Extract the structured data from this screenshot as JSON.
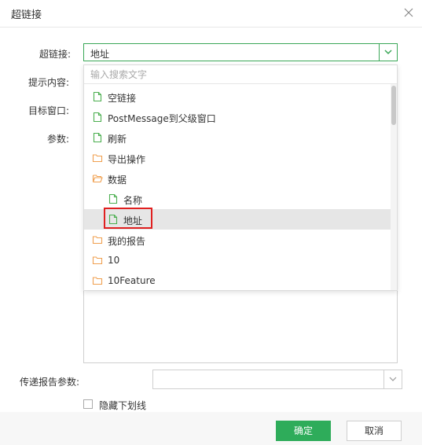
{
  "dialog": {
    "title": "超链接",
    "hyperlink_label": "超链接:",
    "hyperlink_value": "地址",
    "tooltip_label": "提示内容:",
    "target_window_label": "目标窗口:",
    "params_label": "参数:",
    "pass_params_label": "传递报告参数:",
    "underline_label": "隐藏下划线",
    "ok_label": "确定",
    "cancel_label": "取消"
  },
  "dropdown": {
    "search_placeholder": "输入搜索文字",
    "items": [
      {
        "label": "空链接",
        "type": "file",
        "depth": 0,
        "selected": false
      },
      {
        "label": "PostMessage到父级窗口",
        "type": "file",
        "depth": 0,
        "selected": false
      },
      {
        "label": "刷新",
        "type": "file",
        "depth": 0,
        "selected": false
      },
      {
        "label": "导出操作",
        "type": "folder",
        "depth": 0,
        "selected": false
      },
      {
        "label": "数据",
        "type": "folder-open",
        "depth": 0,
        "selected": false
      },
      {
        "label": "名称",
        "type": "file",
        "depth": 1,
        "selected": false
      },
      {
        "label": "地址",
        "type": "file",
        "depth": 1,
        "selected": true
      },
      {
        "label": "我的报告",
        "type": "folder",
        "depth": 0,
        "selected": false
      },
      {
        "label": "10",
        "type": "folder",
        "depth": 0,
        "selected": false
      },
      {
        "label": "10Feature",
        "type": "folder",
        "depth": 0,
        "selected": false
      }
    ]
  },
  "colors": {
    "accent": "#2eac5a",
    "file_icon": "#4caf50",
    "folder_icon": "#f0a050",
    "selected_bg": "#e6e6e6",
    "highlight": "#e02020"
  }
}
